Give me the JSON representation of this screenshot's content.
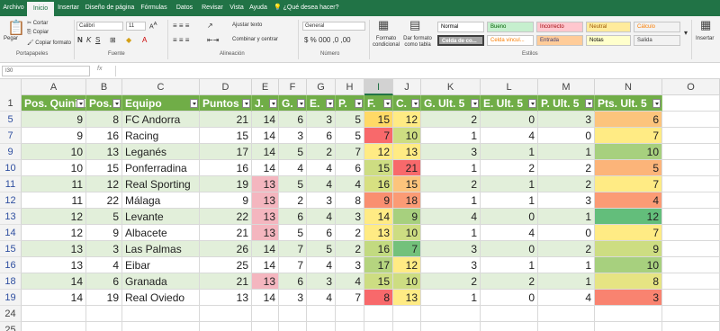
{
  "ribbon": {
    "tabs": [
      "Archivo",
      "Inicio",
      "Insertar",
      "Diseño de página",
      "Fórmulas",
      "Datos",
      "Revisar",
      "Vista",
      "Ayuda"
    ],
    "active_tab": "Inicio",
    "tell_me": "¿Qué desea hacer?",
    "clipboard": {
      "paste": "Pegar",
      "cut": "Cortar",
      "copy": "Copiar",
      "format_painter": "Copiar formato",
      "label": "Portapapeles"
    },
    "font": {
      "name": "Calibri",
      "size": "11",
      "label": "Fuente"
    },
    "alignment": {
      "wrap": "Ajustar texto",
      "merge": "Combinar y centrar",
      "label": "Alineación"
    },
    "number": {
      "format": "General",
      "label": "Número"
    },
    "styles": {
      "conditional": "Formato condicional",
      "as_table": "Dar formato como tabla",
      "cells": [
        "Normal",
        "Bueno",
        "Incorrecto",
        "Neutral",
        "Cálculo",
        "Celda de co...",
        "Celda vincul...",
        "Entrada",
        "Notas",
        "Salida"
      ],
      "label": "Estilos"
    },
    "insert": "Insertar"
  },
  "formula_bar": {
    "name_box": "I30",
    "fx": "fx",
    "content": ""
  },
  "columns": [
    "A",
    "B",
    "C",
    "D",
    "E",
    "F",
    "G",
    "H",
    "I",
    "J",
    "K",
    "L",
    "M",
    "N",
    "O"
  ],
  "selected_column": "I",
  "headers": [
    "Pos. Quiniela",
    "Pos.",
    "Equipo",
    "Puntos",
    "J.",
    "G.",
    "E.",
    "P.",
    "F.",
    "C.",
    "G. Ult. 5",
    "E. Ult. 5",
    "P. Ult. 5",
    "Pts. Ult. 5"
  ],
  "header_row_number": "1",
  "rows": [
    {
      "n": "5",
      "v": [
        9,
        8,
        "FC Andorra",
        21,
        14,
        6,
        3,
        5,
        15,
        12,
        2,
        0,
        3,
        6
      ],
      "band": true
    },
    {
      "n": "7",
      "v": [
        9,
        16,
        "Racing",
        15,
        14,
        3,
        6,
        5,
        7,
        10,
        1,
        4,
        0,
        7
      ],
      "band": false
    },
    {
      "n": "9",
      "v": [
        10,
        13,
        "Leganés",
        17,
        14,
        5,
        2,
        7,
        12,
        13,
        3,
        1,
        1,
        10
      ],
      "band": true
    },
    {
      "n": "10",
      "v": [
        10,
        15,
        "Ponferradina",
        16,
        14,
        4,
        4,
        6,
        15,
        21,
        1,
        2,
        2,
        5
      ],
      "band": false
    },
    {
      "n": "11",
      "v": [
        11,
        12,
        "Real Sporting",
        19,
        13,
        5,
        4,
        4,
        16,
        15,
        2,
        1,
        2,
        7
      ],
      "band": true
    },
    {
      "n": "12",
      "v": [
        11,
        22,
        "Málaga",
        9,
        13,
        2,
        3,
        8,
        9,
        18,
        1,
        1,
        3,
        4
      ],
      "band": false
    },
    {
      "n": "13",
      "v": [
        12,
        5,
        "Levante",
        22,
        13,
        6,
        4,
        3,
        14,
        9,
        4,
        0,
        1,
        12
      ],
      "band": true
    },
    {
      "n": "14",
      "v": [
        12,
        9,
        "Albacete",
        21,
        13,
        5,
        6,
        2,
        13,
        10,
        1,
        4,
        0,
        7
      ],
      "band": false
    },
    {
      "n": "15",
      "v": [
        13,
        3,
        "Las Palmas",
        26,
        14,
        7,
        5,
        2,
        16,
        7,
        3,
        0,
        2,
        9
      ],
      "band": true
    },
    {
      "n": "16",
      "v": [
        13,
        4,
        "Eibar",
        25,
        14,
        7,
        4,
        3,
        17,
        12,
        3,
        1,
        1,
        10
      ],
      "band": false
    },
    {
      "n": "18",
      "v": [
        14,
        6,
        "Granada",
        21,
        13,
        6,
        3,
        4,
        15,
        10,
        2,
        2,
        1,
        8
      ],
      "band": true
    },
    {
      "n": "19",
      "v": [
        14,
        19,
        "Real Oviedo",
        13,
        14,
        3,
        4,
        7,
        8,
        13,
        1,
        0,
        4,
        3
      ],
      "band": false
    }
  ],
  "trailing_rows": [
    "24",
    "25"
  ],
  "colors": {
    "header_green": "#70ad47",
    "band": "#e2efda",
    "pink": "#f4b6bf",
    "F": [
      "#ffd966",
      "#f8696b",
      "#ffeb84",
      "#cddd82",
      "#d7e081",
      "#f98f70",
      "#ffeb84",
      "#ffeb84",
      "#c2da80",
      "#b5d47f",
      "#cddd82",
      "#f8696b"
    ],
    "C": [
      "#ffeb84",
      "#cddd82",
      "#ffeb84",
      "#f8696b",
      "#fcc47c",
      "#fb9b75",
      "#a7d07e",
      "#cddd82",
      "#73c17b",
      "#ffeb84",
      "#cddd82",
      "#ffeb84"
    ],
    "N": [
      "#fcc47c",
      "#ffeb84",
      "#a7d07e",
      "#fcb479",
      "#ffeb84",
      "#fb9b75",
      "#63be7b",
      "#ffeb84",
      "#cddd82",
      "#a7d07e",
      "#e6e483",
      "#f98370"
    ],
    "E_pink_rows": [
      4,
      5,
      6,
      7,
      10
    ]
  }
}
